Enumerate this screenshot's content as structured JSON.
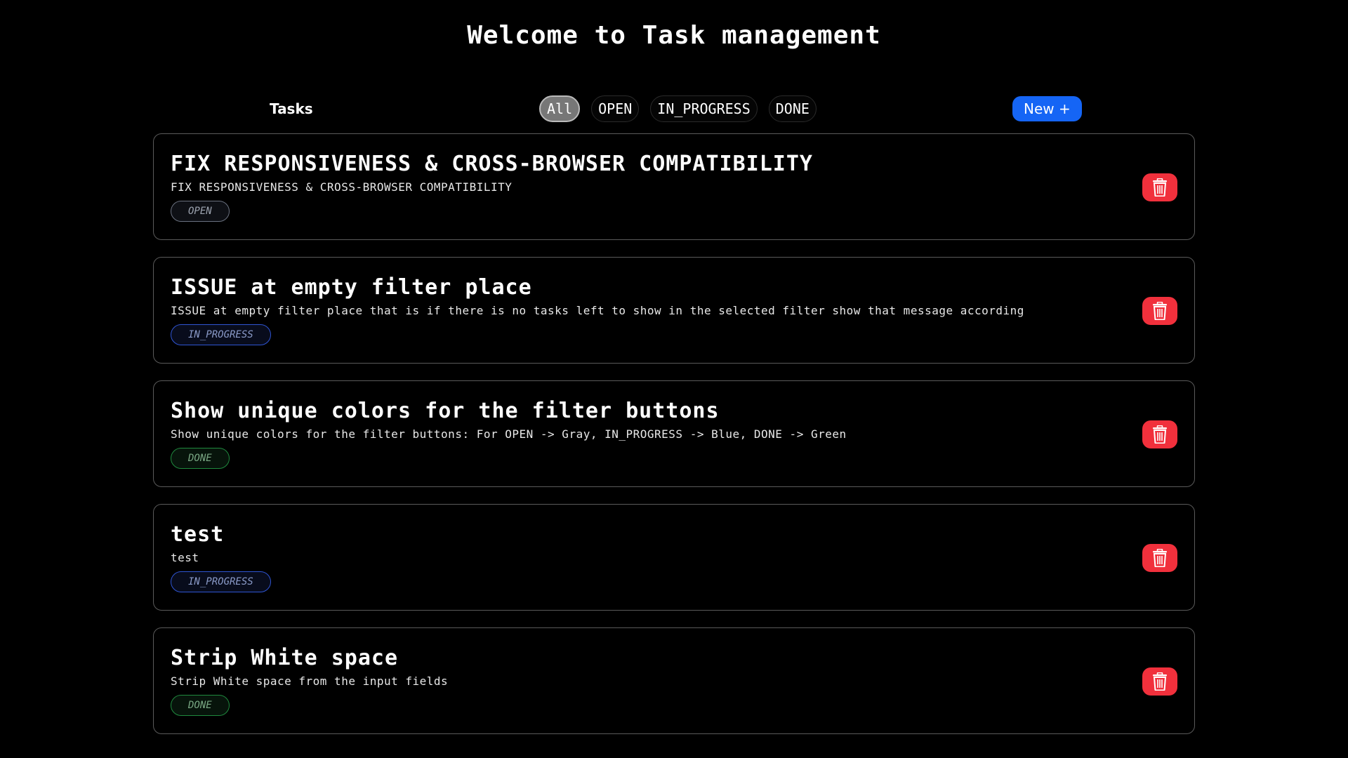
{
  "header": {
    "title": "Welcome to Task management"
  },
  "toolbar": {
    "tasks_label": "Tasks",
    "filters": [
      {
        "label": "All",
        "active": true
      },
      {
        "label": "OPEN",
        "active": false
      },
      {
        "label": "IN_PROGRESS",
        "active": false
      },
      {
        "label": "DONE",
        "active": false
      }
    ],
    "new_button_label": "New +"
  },
  "tasks": [
    {
      "title": "FIX RESPONSIVENESS & CROSS-BROWSER COMPATIBILITY",
      "description": "FIX RESPONSIVENESS & CROSS-BROWSER COMPATIBILITY",
      "status": "OPEN",
      "delete_icon": "trash-icon"
    },
    {
      "title": "ISSUE at empty filter place",
      "description": "ISSUE at empty filter place that is if there is no tasks left to show in the selected filter show that message according",
      "status": "IN_PROGRESS",
      "delete_icon": "trash-icon"
    },
    {
      "title": "Show unique colors for the filter buttons",
      "description": "Show unique colors for the filter buttons: For OPEN -> Gray, IN_PROGRESS -> Blue, DONE -> Green",
      "status": "DONE",
      "delete_icon": "trash-icon"
    },
    {
      "title": "test",
      "description": "test",
      "status": "IN_PROGRESS",
      "delete_icon": "trash-icon"
    },
    {
      "title": "Strip White space",
      "description": "Strip White space from the input fields",
      "status": "DONE",
      "delete_icon": "trash-icon"
    }
  ],
  "colors": {
    "background": "#000000",
    "new_button": "#1565f5",
    "delete_button": "#f1303c",
    "status_open": "#6b7280",
    "status_in_progress": "#2f55d4",
    "status_done": "#1f8a3e"
  }
}
